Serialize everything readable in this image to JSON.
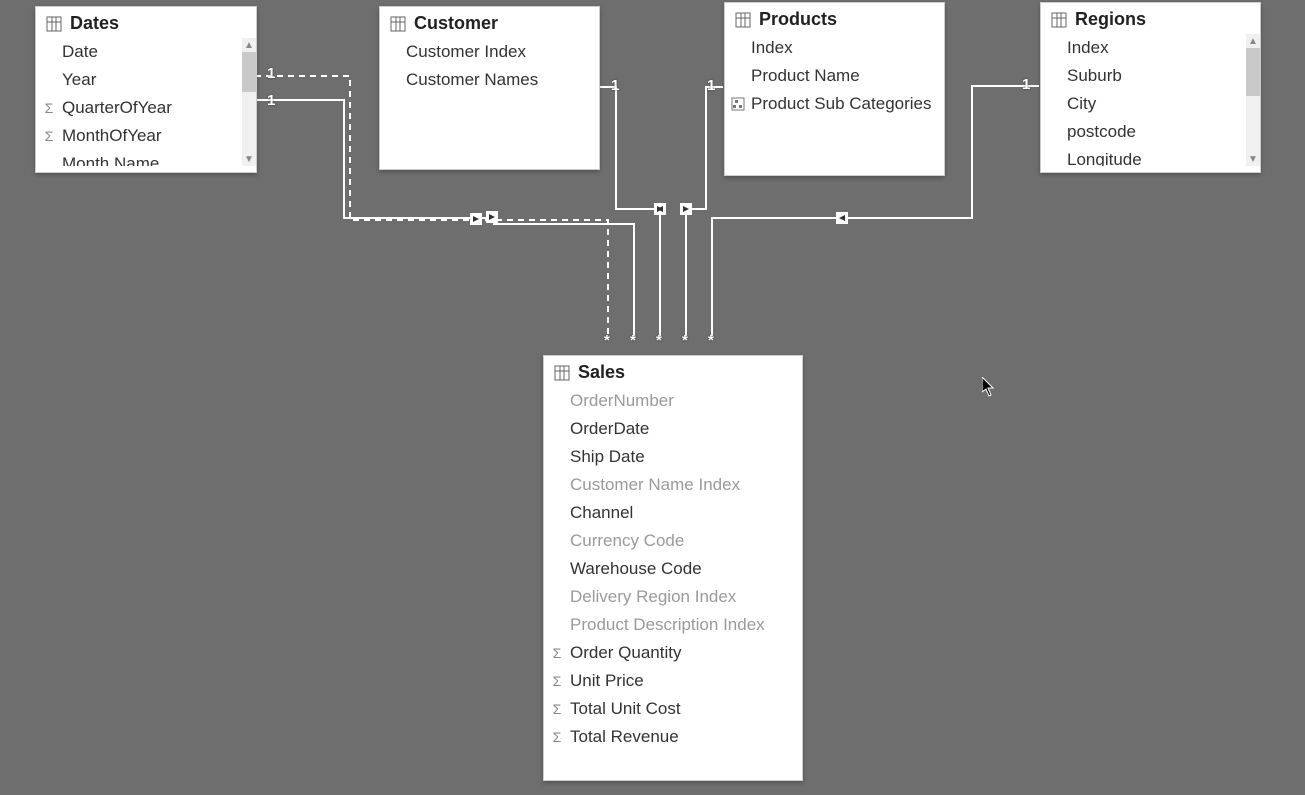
{
  "tables": {
    "dates": {
      "title": "Dates",
      "fields": [
        {
          "name": "Date",
          "icon": null,
          "hidden": false
        },
        {
          "name": "Year",
          "icon": null,
          "hidden": false
        },
        {
          "name": "QuarterOfYear",
          "icon": "sigma",
          "hidden": false
        },
        {
          "name": "MonthOfYear",
          "icon": "sigma",
          "hidden": false
        },
        {
          "name": "Month Name",
          "icon": null,
          "hidden": false
        }
      ]
    },
    "customer": {
      "title": "Customer",
      "fields": [
        {
          "name": "Customer Index",
          "icon": null,
          "hidden": false
        },
        {
          "name": "Customer Names",
          "icon": null,
          "hidden": false
        }
      ]
    },
    "products": {
      "title": "Products",
      "fields": [
        {
          "name": "Index",
          "icon": null,
          "hidden": false
        },
        {
          "name": "Product Name",
          "icon": null,
          "hidden": false
        },
        {
          "name": "Product Sub Categories",
          "icon": "hierarchy",
          "hidden": false
        }
      ]
    },
    "regions": {
      "title": "Regions",
      "fields": [
        {
          "name": "Index",
          "icon": null,
          "hidden": false
        },
        {
          "name": "Suburb",
          "icon": null,
          "hidden": false
        },
        {
          "name": "City",
          "icon": null,
          "hidden": false
        },
        {
          "name": "postcode",
          "icon": null,
          "hidden": false
        },
        {
          "name": "Longitude",
          "icon": null,
          "hidden": false
        }
      ]
    },
    "sales": {
      "title": "Sales",
      "fields": [
        {
          "name": "OrderNumber",
          "icon": null,
          "hidden": true
        },
        {
          "name": "OrderDate",
          "icon": null,
          "hidden": false
        },
        {
          "name": "Ship Date",
          "icon": null,
          "hidden": false
        },
        {
          "name": "Customer Name Index",
          "icon": null,
          "hidden": true
        },
        {
          "name": "Channel",
          "icon": null,
          "hidden": false
        },
        {
          "name": "Currency Code",
          "icon": null,
          "hidden": true
        },
        {
          "name": "Warehouse Code",
          "icon": null,
          "hidden": false
        },
        {
          "name": "Delivery Region Index",
          "icon": null,
          "hidden": true
        },
        {
          "name": "Product Description Index",
          "icon": null,
          "hidden": true
        },
        {
          "name": "Order Quantity",
          "icon": "sigma",
          "hidden": false
        },
        {
          "name": "Unit Price",
          "icon": "sigma",
          "hidden": false
        },
        {
          "name": "Total Unit Cost",
          "icon": "sigma",
          "hidden": false
        },
        {
          "name": "Total Revenue",
          "icon": "sigma",
          "hidden": false
        }
      ]
    }
  },
  "cardinality": {
    "one": "1",
    "many": "*"
  }
}
